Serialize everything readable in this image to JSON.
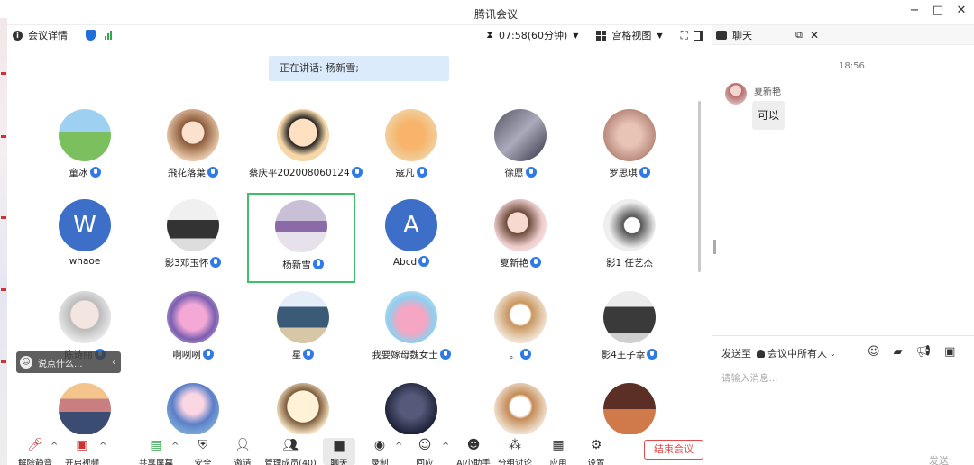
{
  "window": {
    "title": "腾讯会议"
  },
  "meeting_bar": {
    "details_label": "会议详情",
    "timer": "07:58(60分钟)",
    "view_label": "宫格视图"
  },
  "speaking": {
    "text": "正在讲话: 杨新雪;"
  },
  "participants": [
    {
      "name": "童冰",
      "mic": true
    },
    {
      "name": "飛花落葉",
      "mic": true
    },
    {
      "name": "蔡庆平202008060124",
      "mic": true
    },
    {
      "name": "寇凡",
      "mic": true
    },
    {
      "name": "徐愿",
      "mic": true
    },
    {
      "name": "罗思琪",
      "mic": true
    },
    {
      "name": "whaoe",
      "letter": "W",
      "mic": false
    },
    {
      "name": "影3邓玉怀",
      "mic": true
    },
    {
      "name": "杨新雪",
      "mic": true,
      "active": true
    },
    {
      "name": "Abcd",
      "letter": "A",
      "mic": true
    },
    {
      "name": "夏新艳",
      "mic": true
    },
    {
      "name": "影1 任艺杰",
      "mic": false
    },
    {
      "name": "陈诗丽",
      "mic": true
    },
    {
      "name": "啊咧咧",
      "mic": true
    },
    {
      "name": "星",
      "mic": true
    },
    {
      "name": "我要嫁母魏女士",
      "mic": true
    },
    {
      "name": "。",
      "mic": true
    },
    {
      "name": "影4王子幸",
      "mic": true
    },
    {
      "name": "",
      "mic": false
    },
    {
      "name": "",
      "mic": false
    },
    {
      "name": "",
      "mic": false
    },
    {
      "name": "",
      "mic": false
    },
    {
      "name": "",
      "mic": false
    },
    {
      "name": "",
      "mic": false
    }
  ],
  "hint": {
    "text": "说点什么..."
  },
  "toolbar": {
    "unmute": "解除静音",
    "video": "开启视频",
    "share": "共享屏幕",
    "security": "安全",
    "invite": "邀请",
    "members": "管理成员(40)",
    "chat": "聊天",
    "record": "录制",
    "reactions": "回应",
    "ai": "AI小助手",
    "breakout": "分组讨论",
    "apps": "应用",
    "settings": "设置",
    "end": "结束会议"
  },
  "chat": {
    "title": "聊天",
    "time": "18:56",
    "messages": [
      {
        "sender": "夏新艳",
        "text": "可以"
      }
    ],
    "send_to_label": "发送至",
    "send_to_value": "会议中所有人",
    "input_placeholder": "请输入消息...",
    "send_label": "发送"
  },
  "colors": {
    "accent": "#2f7ae5",
    "active_border": "#3fbf6a",
    "end": "#e24b4b"
  }
}
